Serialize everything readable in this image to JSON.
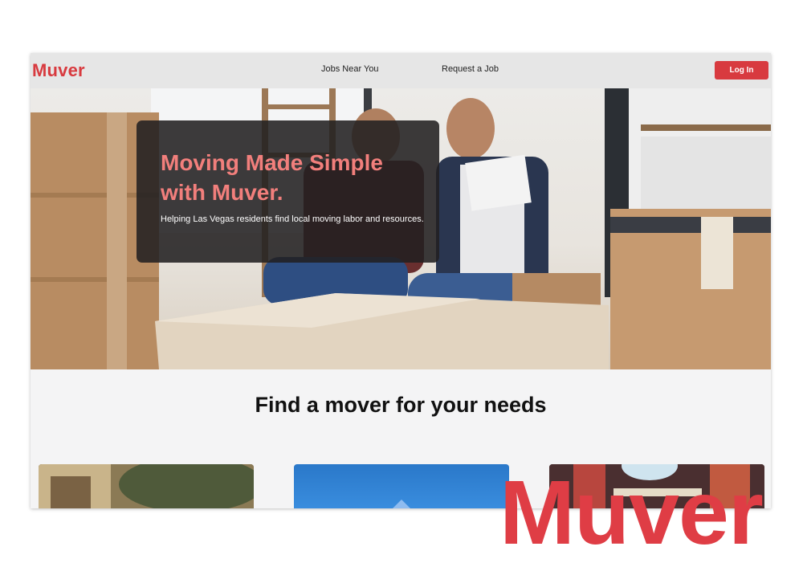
{
  "brand": {
    "name": "Muver",
    "color": "#d83a3f"
  },
  "nav": {
    "links": [
      "Jobs Near You",
      "Request a Job"
    ],
    "login_label": "Log In"
  },
  "hero": {
    "title": "Moving Made Simple with Muver.",
    "subtitle": "Helping Las Vegas residents find local moving labor and resources."
  },
  "section": {
    "title": "Find a mover for your needs"
  },
  "overlay_logo": "Muver"
}
